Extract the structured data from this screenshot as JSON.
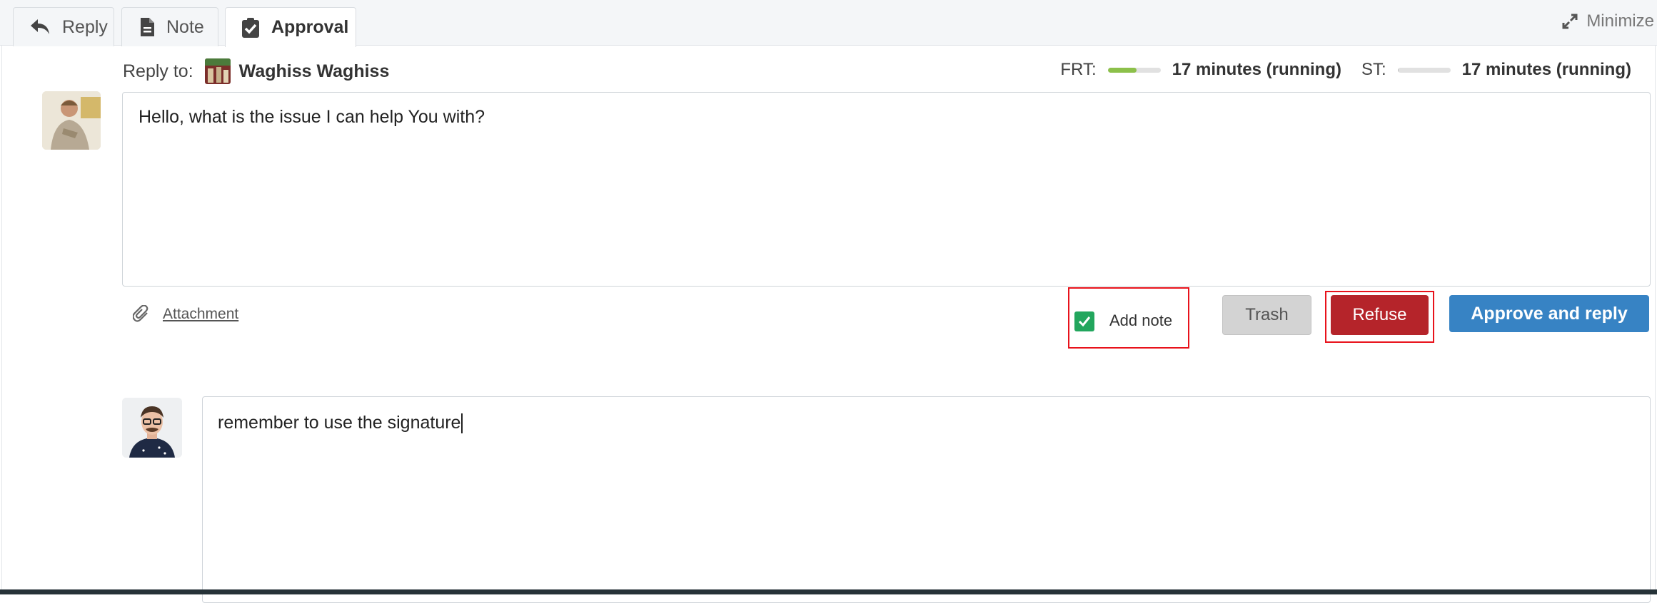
{
  "tabs": [
    {
      "label": "Reply",
      "icon": "reply-icon",
      "active": false
    },
    {
      "label": "Note",
      "icon": "document-icon",
      "active": false
    },
    {
      "label": "Approval",
      "icon": "clipboard-check-icon",
      "active": true
    }
  ],
  "minimize": {
    "label": "Minimize",
    "icon": "expand-arrows-icon"
  },
  "reply": {
    "prefix": "Reply to:",
    "recipient": "Waghiss Waghiss"
  },
  "timers": {
    "frt": {
      "label": "FRT:",
      "value": "17 minutes (running)",
      "progress": 0.55
    },
    "st": {
      "label": "ST:",
      "value": "17 minutes (running)",
      "progress": 0.02
    }
  },
  "message": {
    "text": "Hello, what is the issue I can help You with?"
  },
  "attachment": {
    "label": "Attachment",
    "icon": "paperclip-icon"
  },
  "add_note": {
    "label": "Add note",
    "checked": true
  },
  "buttons": {
    "trash": "Trash",
    "refuse": "Refuse",
    "approve": "Approve and reply"
  },
  "note": {
    "text": "remember to use the signature"
  },
  "colors": {
    "refuse": "#b5242a",
    "approve": "#3783c4",
    "checkbox": "#22a65d",
    "frt_bar": "#8cc04a",
    "highlight": "#e8121b"
  }
}
